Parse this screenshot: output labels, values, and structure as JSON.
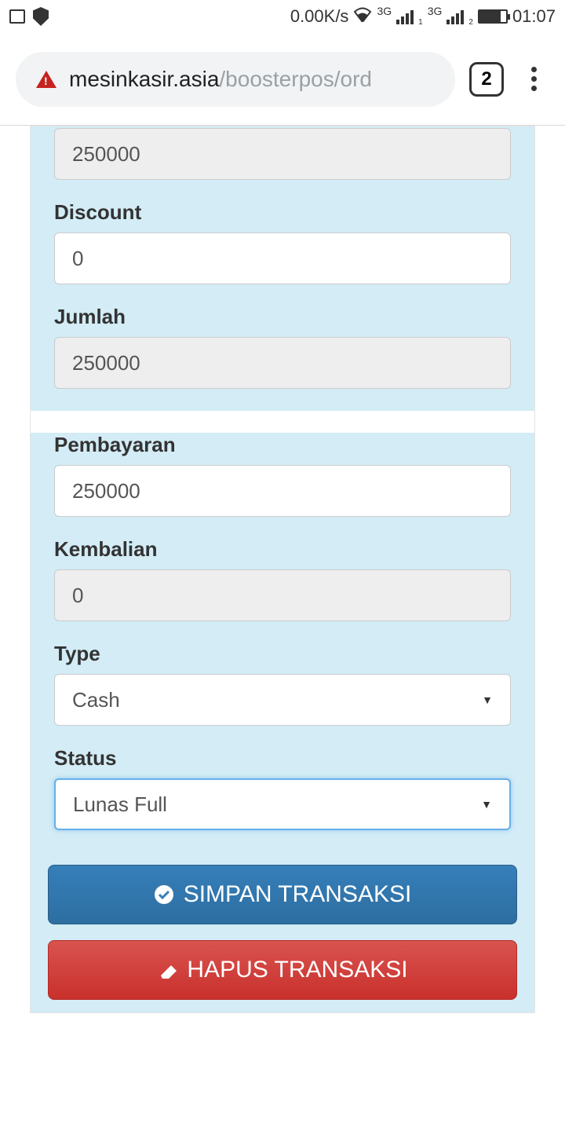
{
  "status_bar": {
    "speed": "0.00K/s",
    "net_label1": "3G",
    "net_label2": "3G",
    "time": "01:07"
  },
  "browser": {
    "url_domain": "mesinkasir.asia",
    "url_path": "/boosterpos/ord",
    "tab_count": "2"
  },
  "form": {
    "panel1": {
      "field1_value": "250000",
      "discount_label": "Discount",
      "discount_value": "0",
      "jumlah_label": "Jumlah",
      "jumlah_value": "250000"
    },
    "panel2": {
      "pembayaran_label": "Pembayaran",
      "pembayaran_value": "250000",
      "kembalian_label": "Kembalian",
      "kembalian_value": "0",
      "type_label": "Type",
      "type_value": "Cash",
      "status_label": "Status",
      "status_value": "Lunas Full"
    }
  },
  "buttons": {
    "save": "SIMPAN TRANSAKSI",
    "delete": "HAPUS TRANSAKSI"
  }
}
